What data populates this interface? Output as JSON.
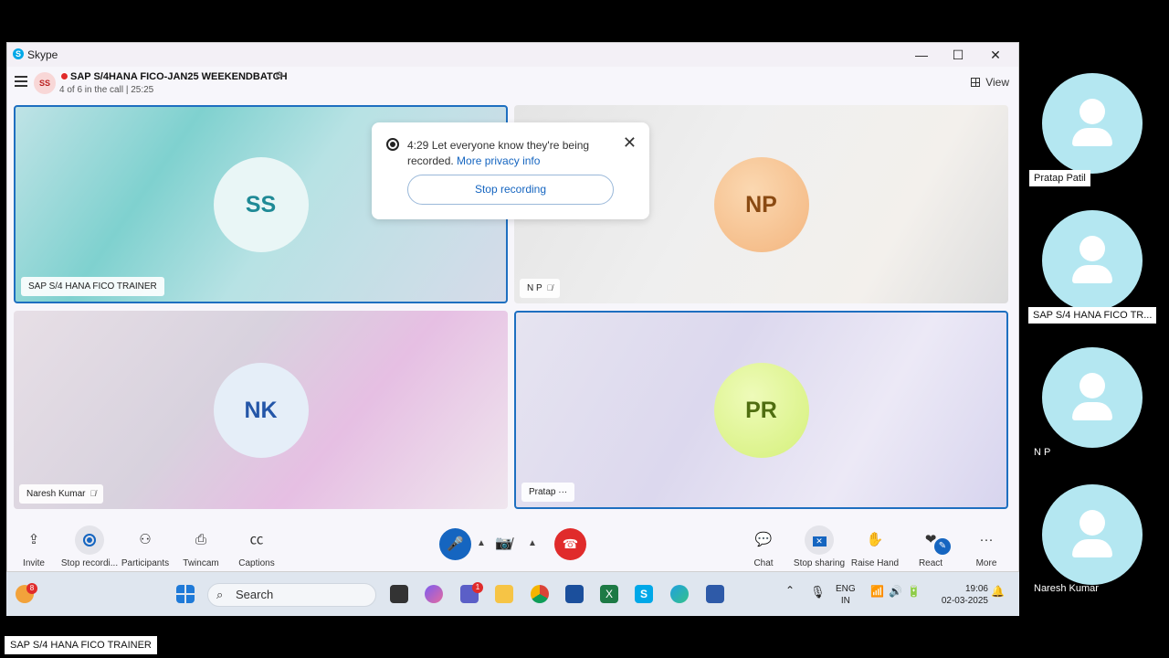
{
  "window": {
    "app_title": "Skype",
    "minimize": "—",
    "maximize": "☐",
    "close": "✕"
  },
  "call": {
    "avatar_initials": "SS",
    "title": "SAP S/4HANA FICO-JAN25 WEEKENDBATCH",
    "subtitle": "4 of 6 in the call | 25:25",
    "view_label": "View"
  },
  "tiles": [
    {
      "initials": "SS",
      "name": "SAP S/4 HANA FICO TRAINER",
      "muted": false
    },
    {
      "initials": "NP",
      "name": "N P",
      "muted": true
    },
    {
      "initials": "NK",
      "name": "Naresh Kumar",
      "muted": true
    },
    {
      "initials": "PR",
      "name": "Pratap",
      "more": "···"
    }
  ],
  "recording_popup": {
    "message": "4:29 Let everyone know they're being recorded.",
    "link": "More privacy info",
    "stop_button": "Stop recording"
  },
  "toolbar": {
    "invite": "Invite",
    "stop_recording": "Stop recordi...",
    "participants": "Participants",
    "twincam": "Twincam",
    "captions": "Captions",
    "chat": "Chat",
    "stop_sharing": "Stop sharing",
    "raise_hand": "Raise Hand",
    "react": "React",
    "more": "More"
  },
  "taskbar": {
    "search_placeholder": "Search",
    "notification_badge": "8",
    "teams_badge": "1",
    "lang_line1": "ENG",
    "lang_line2": "IN",
    "time": "19:06",
    "date": "02-03-2025"
  },
  "side_participants": [
    "Pratap Patil",
    "SAP S/4 HANA FICO TR...",
    "N P",
    "Naresh Kumar"
  ],
  "bottom_label": "SAP S/4 HANA FICO TRAINER",
  "colors": {
    "accent": "#1565c0",
    "end_call": "#e02b2b",
    "side_avatar": "#b4e7f1"
  }
}
